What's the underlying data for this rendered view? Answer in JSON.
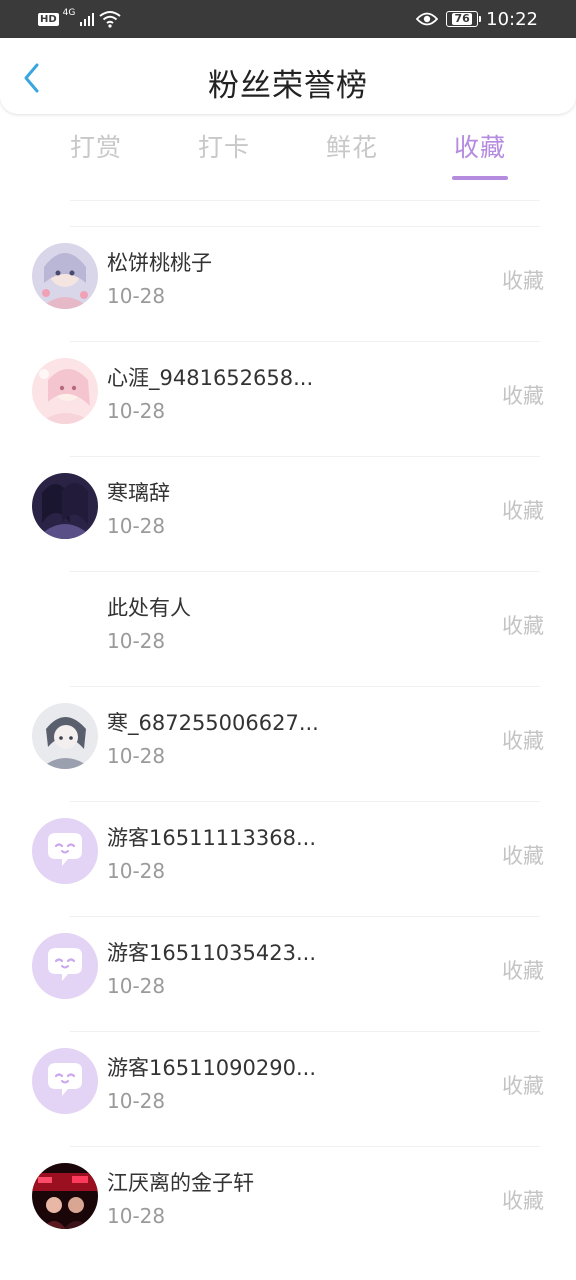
{
  "status_bar": {
    "hd": "HD",
    "network": "4G",
    "battery": "76",
    "time": "10:22"
  },
  "header": {
    "title": "粉丝荣誉榜"
  },
  "tabs": [
    {
      "label": "打赏",
      "active": false
    },
    {
      "label": "打卡",
      "active": false
    },
    {
      "label": "鲜花",
      "active": false
    },
    {
      "label": "收藏",
      "active": true
    }
  ],
  "colors": {
    "accent": "#b58be0",
    "guest_avatar_bg": "#e3d3f5",
    "status_bar_bg": "#3a3a3a"
  },
  "fans": [
    {
      "name": "松饼桃桃子",
      "date": "10-28",
      "action": "收藏",
      "avatar": "photo-icon"
    },
    {
      "name": "心涯_9481652658...",
      "date": "10-28",
      "action": "收藏",
      "avatar": "photo-icon"
    },
    {
      "name": "寒璃辞",
      "date": "10-28",
      "action": "收藏",
      "avatar": "photo-icon"
    },
    {
      "name": "此处有人",
      "date": "10-28",
      "action": "收藏",
      "avatar": "none"
    },
    {
      "name": "寒_687255006627...",
      "date": "10-28",
      "action": "收藏",
      "avatar": "photo-icon"
    },
    {
      "name": "游客16511113368...",
      "date": "10-28",
      "action": "收藏",
      "avatar": "guest-chat-icon"
    },
    {
      "name": "游客16511035423...",
      "date": "10-28",
      "action": "收藏",
      "avatar": "guest-chat-icon"
    },
    {
      "name": "游客16511090290...",
      "date": "10-28",
      "action": "收藏",
      "avatar": "guest-chat-icon"
    },
    {
      "name": "江厌离的金子轩",
      "date": "10-28",
      "action": "收藏",
      "avatar": "photo-icon"
    }
  ]
}
